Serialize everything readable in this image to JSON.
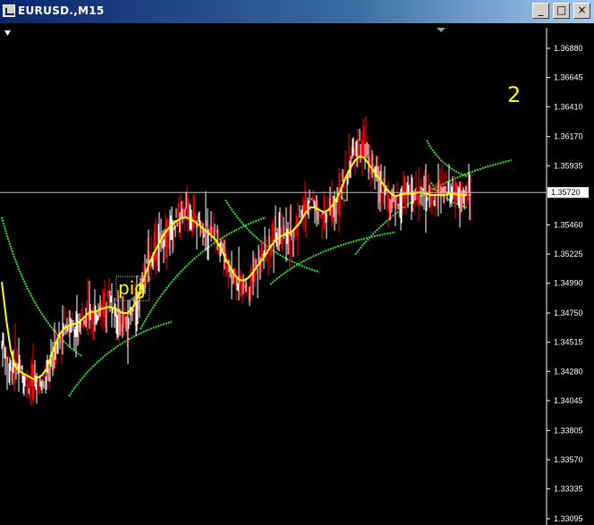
{
  "window": {
    "title": "EURUSD.,M15",
    "minimize_glyph": "_",
    "maximize_glyph": "□",
    "close_glyph": "×"
  },
  "icons": {
    "app": "chart-window-icon",
    "menu": "triangle-down-icon",
    "shift": "triangle-marker-icon"
  },
  "colors": {
    "background": "#000000",
    "candles_up": "#ffffff",
    "candles_down": "#ff0000",
    "ma_fast": "#ffff00",
    "ma_channel": "#33dd33",
    "axis": "#ffffff",
    "text_label": "#ffff00"
  },
  "chart_data": {
    "type": "line",
    "symbol": "EURUSD.",
    "timeframe": "M15",
    "ylim": [
      1.33095,
      1.3688
    ],
    "y_ticks": [
      "1.36880",
      "1.36645",
      "1.36410",
      "1.36170",
      "1.35935",
      "1.35460",
      "1.35225",
      "1.34990",
      "1.34750",
      "1.34515",
      "1.34280",
      "1.34045",
      "1.33805",
      "1.33570",
      "1.33335",
      "1.33095"
    ],
    "current_price": "1.35720",
    "current_price_value": 1.3572,
    "annotations": [
      {
        "text": "pig",
        "x": 26,
        "y": 1.349
      },
      {
        "text": "2",
        "x": 113,
        "y": 1.3645
      }
    ],
    "series": [
      {
        "name": "",
        "kind": "price",
        "values": [
          1.345,
          1.344,
          1.3432,
          1.3436,
          1.3428,
          1.3424,
          1.3418,
          1.3422,
          1.342,
          1.3416,
          1.3424,
          1.3434,
          1.3446,
          1.3458,
          1.3466,
          1.3466,
          1.3462,
          1.3458,
          1.3472,
          1.348,
          1.3476,
          1.3472,
          1.348,
          1.3482,
          1.349,
          1.348,
          1.347,
          1.3468,
          1.3466,
          1.3472,
          1.348,
          1.3496,
          1.3508,
          1.3518,
          1.3522,
          1.3528,
          1.3536,
          1.3542,
          1.3546,
          1.3548,
          1.3552,
          1.3556,
          1.3556,
          1.3552,
          1.3548,
          1.3544,
          1.3542,
          1.354,
          1.3536,
          1.353,
          1.352,
          1.351,
          1.3505,
          1.3498,
          1.3495,
          1.3498,
          1.3505,
          1.351,
          1.3515,
          1.352,
          1.3528,
          1.3535,
          1.3538,
          1.354,
          1.3536,
          1.3538,
          1.3545,
          1.3552,
          1.3558,
          1.3565,
          1.3562,
          1.3555,
          1.355,
          1.3554,
          1.356,
          1.3565,
          1.3575,
          1.3585,
          1.3595,
          1.3602,
          1.361,
          1.3608,
          1.3596,
          1.3588,
          1.3585,
          1.3578,
          1.357,
          1.3564,
          1.356,
          1.3565,
          1.357,
          1.3572,
          1.3568,
          1.357,
          1.3575,
          1.357,
          1.3566,
          1.3568,
          1.3572,
          1.357,
          1.357,
          1.3572,
          1.357,
          1.3566,
          1.357
        ]
      },
      {
        "name": "",
        "kind": "ma_fast",
        "values": [
          1.35,
          1.347,
          1.3445,
          1.3432,
          1.3428,
          1.3426,
          1.3424,
          1.3422,
          1.3423,
          1.3425,
          1.343,
          1.344,
          1.345,
          1.3458,
          1.3463,
          1.3465,
          1.3466,
          1.3467,
          1.347,
          1.3474,
          1.3476,
          1.3476,
          1.3478,
          1.3479,
          1.348,
          1.3479,
          1.3477,
          1.3475,
          1.3475,
          1.3478,
          1.3484,
          1.3494,
          1.3505,
          1.3515,
          1.3523,
          1.353,
          1.3537,
          1.3542,
          1.3546,
          1.3549,
          1.3551,
          1.3552,
          1.3551,
          1.3549,
          1.3546,
          1.3543,
          1.354,
          1.3537,
          1.3533,
          1.3527,
          1.3519,
          1.3512,
          1.3506,
          1.3502,
          1.3501,
          1.3503,
          1.3507,
          1.3512,
          1.3517,
          1.3522,
          1.3528,
          1.3533,
          1.3536,
          1.3538,
          1.3539,
          1.3541,
          1.3545,
          1.355,
          1.3556,
          1.356,
          1.356,
          1.3558,
          1.3556,
          1.3558,
          1.3562,
          1.3568,
          1.3576,
          1.3585,
          1.3592,
          1.3598,
          1.3601,
          1.36,
          1.3595,
          1.359,
          1.3585,
          1.358,
          1.3575,
          1.3571,
          1.3569,
          1.357,
          1.3571,
          1.3571,
          1.3571,
          1.3572,
          1.3572,
          1.3571,
          1.357,
          1.357,
          1.357,
          1.357,
          1.3571,
          1.3571,
          1.357,
          1.357,
          1.357
        ]
      }
    ],
    "channel_segments": [
      {
        "x0": 0,
        "x1": 18,
        "y0": 1.3552,
        "y1": 1.344,
        "curve": "down"
      },
      {
        "x0": 15,
        "x1": 38,
        "y0": 1.3408,
        "y1": 1.3468,
        "curve": "up"
      },
      {
        "x0": 29,
        "x1": 31,
        "y0": 1.3487,
        "y1": 1.3483,
        "curve": "down"
      },
      {
        "x0": 31,
        "x1": 59,
        "y0": 1.3462,
        "y1": 1.3552,
        "curve": "up"
      },
      {
        "x0": 50,
        "x1": 71,
        "y0": 1.3566,
        "y1": 1.3508,
        "curve": "down"
      },
      {
        "x0": 60,
        "x1": 88,
        "y0": 1.3498,
        "y1": 1.354,
        "curve": "up"
      },
      {
        "x0": 75,
        "x1": 77,
        "y0": 1.3575,
        "y1": 1.3565,
        "curve": "down"
      },
      {
        "x0": 79,
        "x1": 114,
        "y0": 1.3522,
        "y1": 1.3598,
        "curve": "up"
      },
      {
        "x0": 96,
        "x1": 105,
        "y0": 1.3575,
        "y1": 1.357,
        "curve": "down"
      },
      {
        "x0": 96,
        "x1": 104,
        "y0": 1.358,
        "y1": 1.356,
        "curve": "up"
      },
      {
        "x0": 95,
        "x1": 104,
        "y0": 1.3614,
        "y1": 1.3585,
        "curve": "down"
      }
    ]
  }
}
